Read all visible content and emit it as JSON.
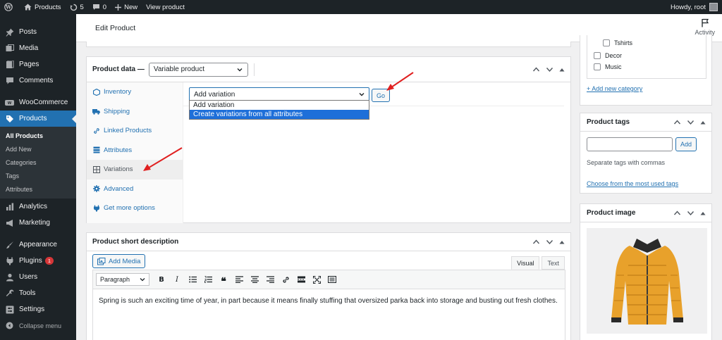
{
  "adminbar": {
    "site_name": "Products",
    "updates_count": "5",
    "comments_count": "0",
    "new_label": "New",
    "view_label": "View product",
    "greeting": "Howdy, root"
  },
  "sidebar": {
    "items": [
      {
        "label": "Posts",
        "icon": "pin-icon"
      },
      {
        "label": "Media",
        "icon": "media-icon"
      },
      {
        "label": "Pages",
        "icon": "pages-icon"
      },
      {
        "label": "Comments",
        "icon": "comments-icon"
      },
      {
        "label": "WooCommerce",
        "icon": "woo-icon"
      },
      {
        "label": "Products",
        "icon": "products-icon"
      },
      {
        "label": "Analytics",
        "icon": "analytics-icon"
      },
      {
        "label": "Marketing",
        "icon": "megaphone-icon"
      },
      {
        "label": "Appearance",
        "icon": "brush-icon"
      },
      {
        "label": "Plugins",
        "icon": "plugin-icon"
      },
      {
        "label": "Users",
        "icon": "users-icon"
      },
      {
        "label": "Tools",
        "icon": "wrench-icon"
      },
      {
        "label": "Settings",
        "icon": "settings-icon"
      },
      {
        "label": "Collapse menu",
        "icon": "collapse-icon"
      }
    ],
    "plugins_badge": "1",
    "submenu": [
      "All Products",
      "Add New",
      "Categories",
      "Tags",
      "Attributes"
    ]
  },
  "header": {
    "title": "Edit Product",
    "activity_label": "Activity"
  },
  "product_data": {
    "label": "Product data —",
    "type_value": "Variable product",
    "tabs": [
      {
        "label": "Inventory",
        "icon": "inventory-icon"
      },
      {
        "label": "Shipping",
        "icon": "truck-icon"
      },
      {
        "label": "Linked Products",
        "icon": "link-icon"
      },
      {
        "label": "Attributes",
        "icon": "list-icon"
      },
      {
        "label": "Variations",
        "icon": "grid-icon"
      },
      {
        "label": "Advanced",
        "icon": "gear-icon"
      },
      {
        "label": "Get more options",
        "icon": "plugin-icon"
      }
    ],
    "variation_select_value": "Add variation",
    "go_label": "Go",
    "dropdown_options": [
      "Add variation",
      "Create variations from all attributes"
    ]
  },
  "short_description": {
    "title": "Product short description",
    "add_media_label": "Add Media",
    "tab_visual": "Visual",
    "tab_text": "Text",
    "format_value": "Paragraph",
    "content": "Spring is such an exciting time of year, in part because it means finally stuffing that oversized parka back into storage and busting out fresh clothes."
  },
  "categories": {
    "items": [
      "Tshirts",
      "Decor",
      "Music"
    ],
    "add_link": "+ Add new category"
  },
  "tags": {
    "title": "Product tags",
    "add_label": "Add",
    "help": "Separate tags with commas",
    "link": "Choose from the most used tags"
  },
  "product_image": {
    "title": "Product image"
  },
  "colors": {
    "accent": "#2271b1",
    "sidebar_bg": "#1d2327",
    "annotation": "#e02020"
  }
}
